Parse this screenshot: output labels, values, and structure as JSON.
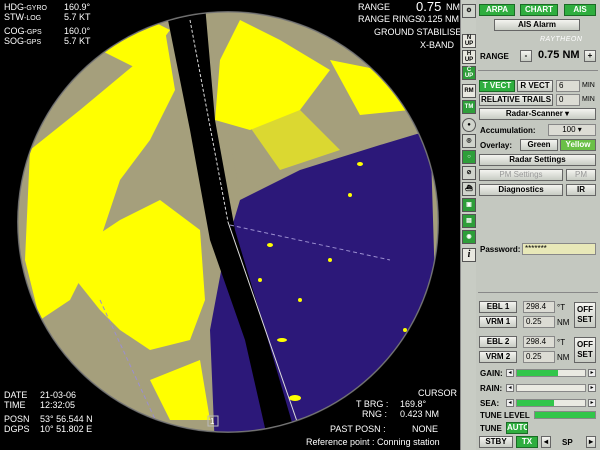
{
  "overlay": {
    "hdg_label": "HDG",
    "hdg_src": "-GYRO",
    "hdg_value": "160.9°",
    "stw_label": "STW",
    "stw_src": "-LOG",
    "stw_value": "5.7 KT",
    "cog_label": "COG",
    "cog_src": "-GPS",
    "cog_value": "160.0°",
    "sog_label": "SOG",
    "sog_src": "-GPS",
    "sog_value": "5.7 KT",
    "range_label": "RANGE",
    "range_value": "0.75",
    "range_unit": "NM",
    "rings_label": "RANGE RINGS",
    "rings_value": "0.125 NM",
    "stabilised": "GROUND STABILISED",
    "band": "X-BAND",
    "date_label": "DATE",
    "date_value": "21-03-06",
    "time_label": "TIME",
    "time_value": "12:32:05",
    "posn_label": "POSN",
    "posn_value": "53° 56.544 N",
    "dgps_label": "DGPS",
    "dgps_value": "10° 51.802 E",
    "cursor_label": "CURSOR",
    "tbrg_label": "T BRG :",
    "tbrg_value": "169.8°",
    "rng_label": "RNG :",
    "rng_value": "0.423 NM",
    "past_posn_label": "PAST POSN :",
    "past_posn_value": "NONE",
    "reference_point": "Reference point : Conning station",
    "marker": "1"
  },
  "iconbar": {
    "items": [
      {
        "name": "north-up-icon",
        "text": "N UP"
      },
      {
        "name": "head-up-icon",
        "text": "H UP"
      },
      {
        "name": "course-up-icon",
        "text": "C UP"
      },
      {
        "name": "relative-motion-icon",
        "text": "RM"
      },
      {
        "name": "true-motion-icon",
        "text": "TM"
      }
    ]
  },
  "panel": {
    "arpa": "ARPA",
    "chart": "CHART",
    "ais": "AIS",
    "ais_alarm": "AIS Alarm",
    "brand": "RAYTHEON",
    "range_label": "RANGE",
    "range_minus": "-",
    "range_value": "0.75 NM",
    "range_plus": "+",
    "t_vect": "T VECT",
    "r_vect": "R VECT",
    "vect_min": "6",
    "vect_min_unit": "MIN",
    "relative_trails": "RELATIVE TRAILS",
    "trails_min": "0",
    "trails_min_unit": "MIN",
    "radar_scanner": "Radar-Scanner",
    "accumulation_label": "Accumulation:",
    "accumulation_value": "100",
    "overlay_label": "Overlay:",
    "overlay_green": "Green",
    "overlay_yellow": "Yellow",
    "radar_settings": "Radar Settings",
    "pm_settings": "PM Settings",
    "pm": "PM",
    "diagnostics": "Diagnostics",
    "ir": "IR",
    "password_label": "Password:",
    "password_value": "*******",
    "ebl1": "EBL 1",
    "ebl1_value": "298.4",
    "ebl1_unit": "°T",
    "vrm1": "VRM 1",
    "vrm1_value": "0.25",
    "vrm1_unit": "NM",
    "offset1": "OFF SET",
    "ebl2": "EBL 2",
    "ebl2_value": "298.4",
    "ebl2_unit": "°T",
    "vrm2": "VRM 2",
    "vrm2_value": "0.25",
    "vrm2_unit": "NM",
    "offset2": "OFF SET",
    "gain_label": "GAIN:",
    "gain_level": 0.6,
    "rain_label": "RAIN:",
    "rain_level": 0.0,
    "sea_label": "SEA:",
    "sea_level": 0.55,
    "tune_level_label": "TUNE LEVEL",
    "tune_level": 1.0,
    "tune_label": "TUNE",
    "tune_auto": "AUTO",
    "stby": "STBY",
    "tx": "TX",
    "sp": "SP"
  },
  "colors": {
    "land": "#a59f7c",
    "water": "#2c1879",
    "echo": "#ffff00",
    "accent_green": "#2fae3f",
    "panel_bg": "#c4c8c0"
  }
}
